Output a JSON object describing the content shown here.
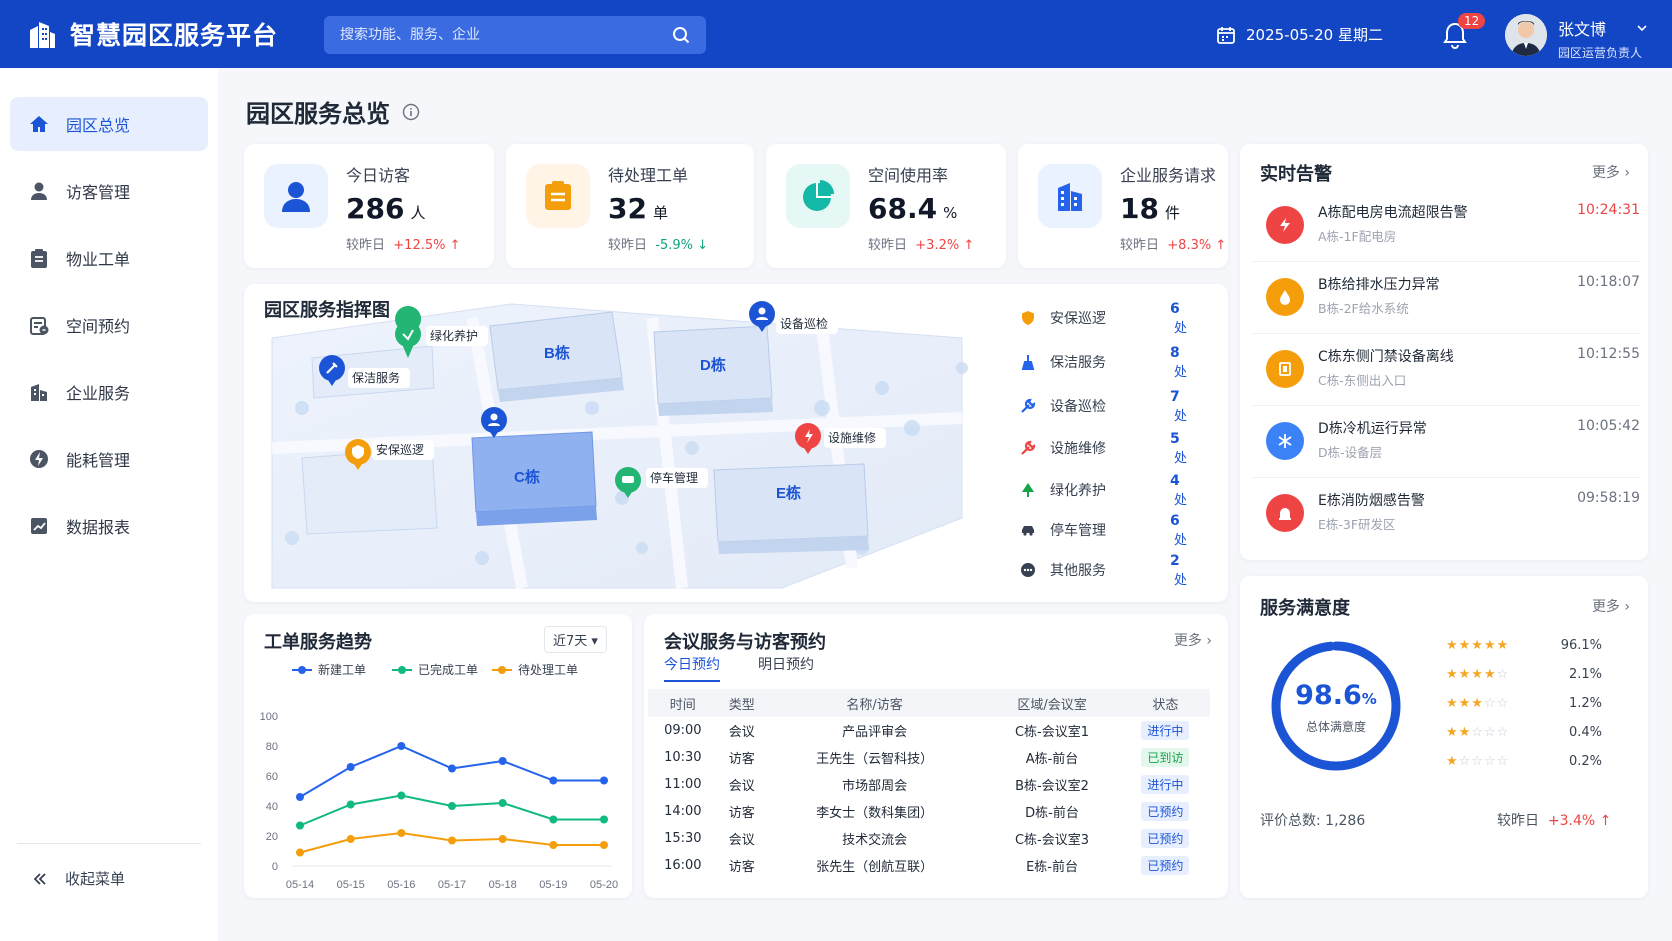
{
  "header": {
    "app_title": "智慧园区服务平台",
    "search_placeholder": "搜索功能、服务、企业",
    "date": "2025-05-20 星期二",
    "notifications": "12",
    "user_name": "张文博",
    "user_role": "园区运营负责人"
  },
  "sidebar": {
    "items": [
      {
        "label": "园区总览",
        "icon": "home-icon"
      },
      {
        "label": "访客管理",
        "icon": "user-icon"
      },
      {
        "label": "物业工单",
        "icon": "clipboard-icon"
      },
      {
        "label": "空间预约",
        "icon": "calendar-edit-icon"
      },
      {
        "label": "企业服务",
        "icon": "building-icon"
      },
      {
        "label": "能耗管理",
        "icon": "lightning-icon"
      },
      {
        "label": "数据报表",
        "icon": "chart-icon"
      }
    ],
    "collapse_label": "收起菜单"
  },
  "page": {
    "title": "园区服务总览"
  },
  "stats": [
    {
      "label": "今日访客",
      "value": "286",
      "unit": "人",
      "cmp_label": "较昨日",
      "delta": "+12.5%",
      "arrow": "↑",
      "color": "#1c54d6"
    },
    {
      "label": "待处理工单",
      "value": "32",
      "unit": "单",
      "cmp_label": "较昨日",
      "delta": "-5.9%",
      "arrow": "↓",
      "color": "#f59e0b"
    },
    {
      "label": "空间使用率",
      "value": "68.4",
      "unit": "%",
      "cmp_label": "较昨日",
      "delta": "+3.2%",
      "arrow": "↑",
      "color": "#14b8a6"
    },
    {
      "label": "企业服务请求",
      "value": "18",
      "unit": "件",
      "cmp_label": "较昨日",
      "delta": "+8.3%",
      "arrow": "↑",
      "color": "#2563eb"
    }
  ],
  "map": {
    "title": "园区服务指挥图",
    "buildings": [
      "B栋",
      "D栋",
      "C栋",
      "E栋"
    ],
    "pins": [
      "绿化养护",
      "设备巡检",
      "保洁服务",
      "安保巡逻",
      "设施维修",
      "停车管理"
    ],
    "legend": [
      {
        "label": "安保巡逻",
        "count": "6",
        "unit": "处",
        "color": "#f59e0b"
      },
      {
        "label": "保洁服务",
        "count": "8",
        "unit": "处",
        "color": "#2563eb"
      },
      {
        "label": "设备巡检",
        "count": "7",
        "unit": "处",
        "color": "#2563eb"
      },
      {
        "label": "设施维修",
        "count": "5",
        "unit": "处",
        "color": "#ef4444"
      },
      {
        "label": "绿化养护",
        "count": "4",
        "unit": "处",
        "color": "#16a34a"
      },
      {
        "label": "停车管理",
        "count": "6",
        "unit": "处",
        "color": "#374151"
      },
      {
        "label": "其他服务",
        "count": "2",
        "unit": "处",
        "color": "#374151"
      }
    ]
  },
  "alerts": {
    "title": "实时告警",
    "more": "更多",
    "items": [
      {
        "title": "A栋配电房电流超限告警",
        "sub": "A栋-1F配电房",
        "time": "10:24:31",
        "color": "#ef4444",
        "icon": "lightning-icon"
      },
      {
        "title": "B栋给排水压力异常",
        "sub": "B栋-2F给水系统",
        "time": "10:18:07",
        "color": "#f59e0b",
        "icon": "water-drop-icon"
      },
      {
        "title": "C栋东侧门禁设备离线",
        "sub": "C栋-东侧出入口",
        "time": "10:12:55",
        "color": "#f59e0b",
        "icon": "door-icon"
      },
      {
        "title": "D栋冷机运行异常",
        "sub": "D栋-设备层",
        "time": "10:05:42",
        "color": "#3b82f6",
        "icon": "snowflake-icon"
      },
      {
        "title": "E栋消防烟感告警",
        "sub": "E栋-3F研发区",
        "time": "09:58:19",
        "color": "#ef4444",
        "icon": "alarm-icon"
      }
    ]
  },
  "trend": {
    "title": "工单服务趋势",
    "range": "近7天",
    "series_names": [
      "新建工单",
      "已完成工单",
      "待处理工单"
    ]
  },
  "chart_data": {
    "type": "line",
    "x": [
      "05-14",
      "05-15",
      "05-16",
      "05-17",
      "05-18",
      "05-19",
      "05-20"
    ],
    "ylim": [
      0,
      100
    ],
    "yticks": [
      0,
      20,
      40,
      60,
      80,
      100
    ],
    "series": [
      {
        "name": "新建工单",
        "color": "#2563eb",
        "values": [
          46,
          66,
          80,
          65,
          70,
          57,
          57
        ]
      },
      {
        "name": "已完成工单",
        "color": "#10b981",
        "values": [
          27,
          41,
          47,
          40,
          42,
          31,
          31
        ]
      },
      {
        "name": "待处理工单",
        "color": "#f59e0b",
        "values": [
          9,
          18,
          22,
          17,
          18,
          14,
          14
        ]
      }
    ]
  },
  "meetings": {
    "title": "会议服务与访客预约",
    "more": "更多",
    "tabs": [
      "今日预约",
      "明日预约"
    ],
    "columns": [
      "时间",
      "类型",
      "名称/访客",
      "区域/会议室",
      "状态"
    ],
    "rows": [
      [
        "09:00",
        "会议",
        "产品评审会",
        "C栋-会议室1",
        "进行中"
      ],
      [
        "10:30",
        "访客",
        "王先生（云智科技）",
        "A栋-前台",
        "已到访"
      ],
      [
        "11:00",
        "会议",
        "市场部周会",
        "B栋-会议室2",
        "进行中"
      ],
      [
        "14:00",
        "访客",
        "李女士（数科集团）",
        "D栋-前台",
        "已预约"
      ],
      [
        "15:30",
        "会议",
        "技术交流会",
        "C栋-会议室3",
        "已预约"
      ],
      [
        "16:00",
        "访客",
        "张先生（创航互联）",
        "E栋-前台",
        "已预约"
      ]
    ]
  },
  "satisfaction": {
    "title": "服务满意度",
    "more": "更多",
    "score": "98.6",
    "score_unit": "%",
    "score_label": "总体满意度",
    "score_fraction": 0.986,
    "rows": [
      {
        "stars": 5,
        "pct": "96.1%"
      },
      {
        "stars": 4,
        "pct": "2.1%"
      },
      {
        "stars": 3,
        "pct": "1.2%"
      },
      {
        "stars": 2,
        "pct": "0.4%"
      },
      {
        "stars": 1,
        "pct": "0.2%"
      }
    ],
    "total_label": "评价总数:",
    "total": "1,286",
    "cmp_label": "较昨日",
    "delta": "+3.4%",
    "arrow": "↑"
  }
}
